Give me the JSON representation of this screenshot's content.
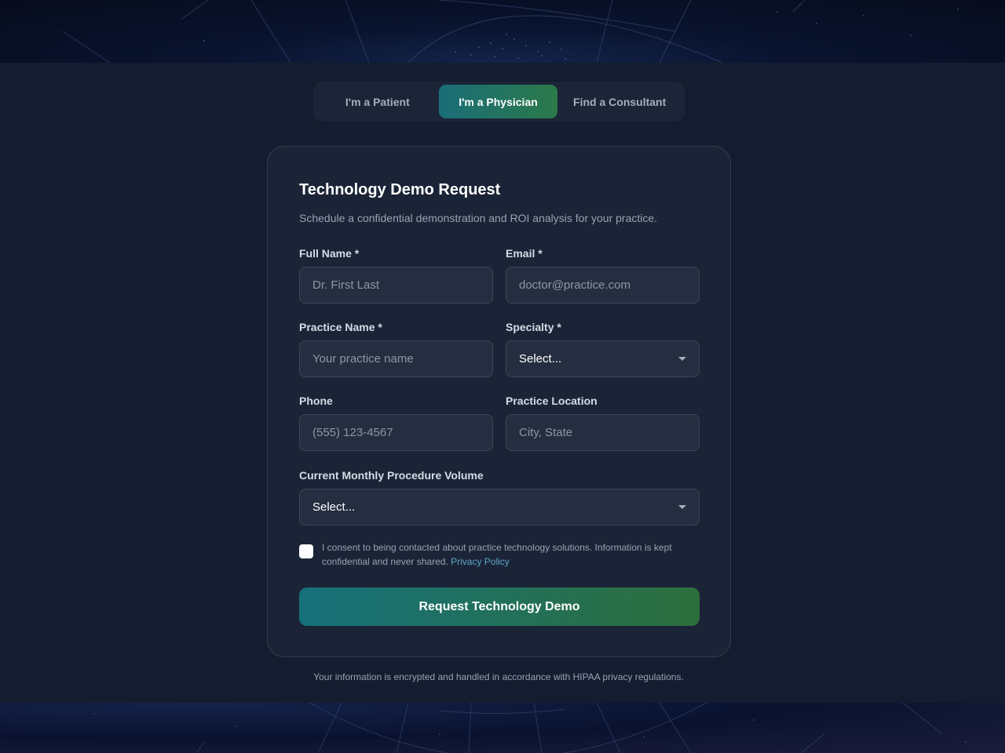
{
  "tabs": [
    {
      "label": "I'm a Patient",
      "active": false
    },
    {
      "label": "I'm a Physician",
      "active": true
    },
    {
      "label": "Find a Consultant",
      "active": false
    }
  ],
  "form": {
    "title": "Technology Demo Request",
    "subtitle": "Schedule a confidential demonstration and ROI analysis for your practice.",
    "full_name": {
      "label": "Full Name *",
      "placeholder": "Dr. First Last"
    },
    "email": {
      "label": "Email *",
      "placeholder": "doctor@practice.com"
    },
    "practice_name": {
      "label": "Practice Name *",
      "placeholder": "Your practice name"
    },
    "specialty": {
      "label": "Specialty *",
      "value": "Select..."
    },
    "phone": {
      "label": "Phone",
      "placeholder": "(555) 123-4567"
    },
    "location": {
      "label": "Practice Location",
      "placeholder": "City, State"
    },
    "volume": {
      "label": "Current Monthly Procedure Volume",
      "value": "Select..."
    },
    "consent": {
      "text": "I consent to being contacted about practice technology solutions. Information is kept confidential and never shared.",
      "link": "Privacy Policy",
      "checked": false
    },
    "submit_label": "Request Technology Demo"
  },
  "footnote": "Your information is encrypted and handled in accordance with HIPAA privacy regulations.",
  "colors": {
    "accent_start": "#1a6d78",
    "accent_end": "#2b7a4a",
    "link": "#5fa6c9",
    "background": "#141d2f",
    "card": "#1b2436"
  }
}
